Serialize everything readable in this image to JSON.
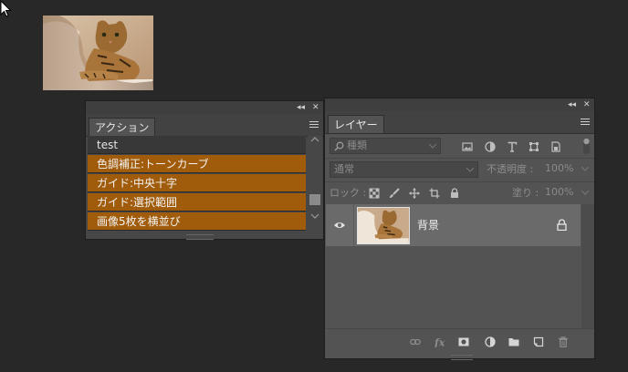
{
  "actions_panel": {
    "tab_label": "アクション",
    "items": [
      {
        "label": "test",
        "style": "plain"
      },
      {
        "label": "色調補正:トーンカーブ",
        "style": "orange"
      },
      {
        "label": "ガイド:中央十字",
        "style": "orange"
      },
      {
        "label": "ガイド:選択範囲",
        "style": "orange"
      },
      {
        "label": "画像5枚を横並び",
        "style": "orange"
      }
    ]
  },
  "layers_panel": {
    "tab_label": "レイヤー",
    "filter": {
      "value": "種類"
    },
    "blend_mode": {
      "value": "通常"
    },
    "opacity": {
      "label": "不透明度 :",
      "value": "100%"
    },
    "lock": {
      "label": "ロック :"
    },
    "fill": {
      "label": "塗り :",
      "value": "100%"
    },
    "layers": [
      {
        "name": "背景",
        "visible": true,
        "locked": true
      }
    ]
  },
  "colors": {
    "background": "#282828",
    "panel": "#535353",
    "action_highlight": "#a15c0b",
    "selected_layer": "#6a6a6a"
  }
}
